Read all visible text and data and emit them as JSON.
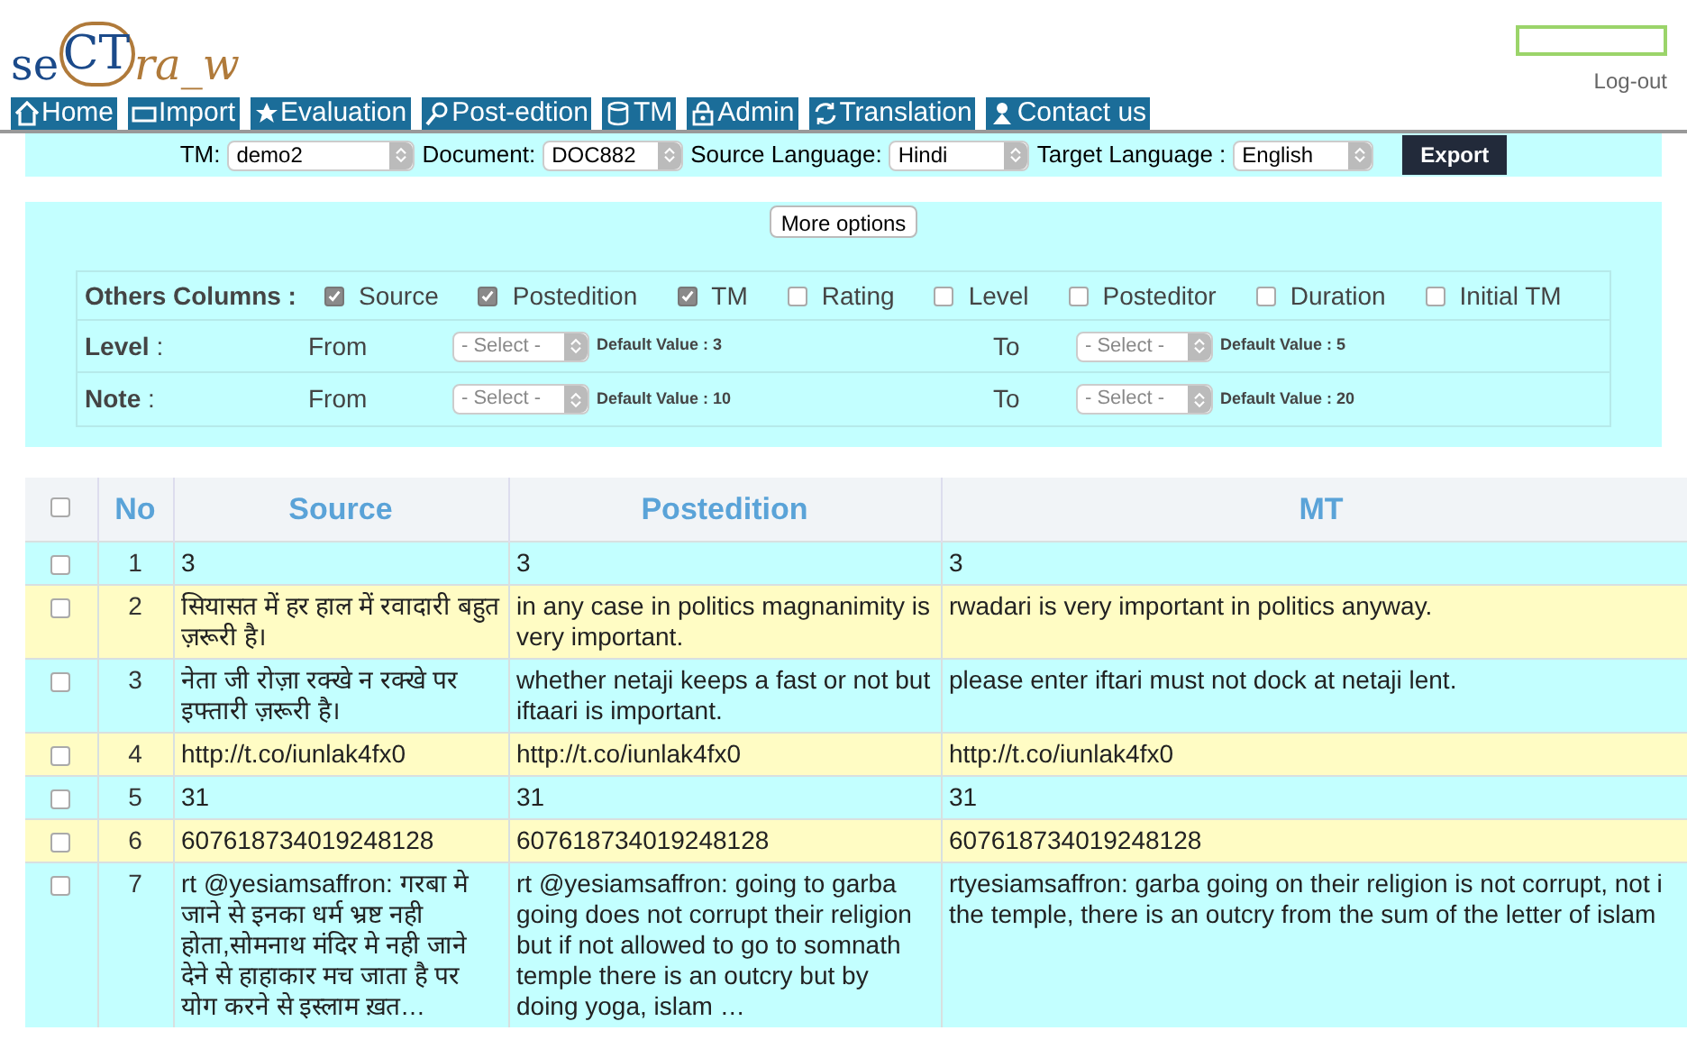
{
  "logo": {
    "text_start": "se",
    "text_circle": "CT",
    "text_end": "ra_w"
  },
  "logout": "Log-out",
  "nav": [
    {
      "label": "Home",
      "kind": "home"
    },
    {
      "label": "Import",
      "kind": "import"
    },
    {
      "label": "Evaluation",
      "kind": "star"
    },
    {
      "label": "Post-edtion",
      "kind": "search"
    },
    {
      "label": "TM",
      "kind": "db"
    },
    {
      "label": "Admin",
      "kind": "lock"
    },
    {
      "label": "Translation",
      "kind": "sync"
    },
    {
      "label": "Contact us",
      "kind": "person"
    }
  ],
  "toolbar": {
    "fields": [
      {
        "label": "TM:",
        "value": "demo2"
      },
      {
        "label": "Document:",
        "value": "DOC882"
      },
      {
        "label": "Source Language:",
        "value": "Hindi"
      },
      {
        "label": "Target Language :",
        "value": "English"
      }
    ],
    "export": "Export"
  },
  "more_options": "More options",
  "others_columns": {
    "label": "Others Columns :",
    "options": [
      {
        "label": "Source",
        "checked": true
      },
      {
        "label": "Postedition",
        "checked": true
      },
      {
        "label": "TM",
        "checked": true
      },
      {
        "label": "Rating",
        "checked": false
      },
      {
        "label": "Level",
        "checked": false
      },
      {
        "label": "Posteditor",
        "checked": false
      },
      {
        "label": "Duration",
        "checked": false
      },
      {
        "label": "Initial TM",
        "checked": false
      }
    ]
  },
  "filters": [
    {
      "label": "**Level** :",
      "from": "From",
      "from_select": "- Select -",
      "from_default": "Default Value : 3",
      "to": "To",
      "to_select": "- Select -",
      "to_default": "Default Value : 5"
    },
    {
      "label": "**Note** :",
      "from": "From",
      "from_select": "- Select -",
      "from_default": "Default Value : 10",
      "to": "To",
      "to_select": "- Select -",
      "to_default": "Default Value : 20"
    }
  ],
  "table": {
    "columns": [
      "No",
      "Source",
      "Postedition",
      "MT"
    ],
    "header_checked": false,
    "rows": [
      {
        "checked": false,
        "no": "1",
        "source": "3",
        "postedition": "3",
        "mt": "3"
      },
      {
        "checked": false,
        "no": "2",
        "source": "सियासत में हर हाल में रवादारी बहुत ज़रूरी है।",
        "postedition": "in any case in politics magnanimity is very important.",
        "mt": "rwadari is very important in politics anyway."
      },
      {
        "checked": false,
        "no": "3",
        "source": "नेता जी रोज़ा रक्खे न रक्खे पर इफ्तारी ज़रूरी है।",
        "postedition": "whether netaji keeps a fast or not but iftaari is important.",
        "mt": "please enter iftari must not dock at netaji lent."
      },
      {
        "checked": false,
        "no": "4",
        "source": "http://t.co/iunlak4fx0",
        "postedition": "http://t.co/iunlak4fx0",
        "mt": "http://t.co/iunlak4fx0"
      },
      {
        "checked": false,
        "no": "5",
        "source": "31",
        "postedition": "31",
        "mt": "31"
      },
      {
        "checked": false,
        "no": "6",
        "source": "607618734019248128",
        "postedition": "607618734019248128",
        "mt": "607618734019248128"
      },
      {
        "checked": false,
        "no": "7",
        "source": "rt @yesiamsaffron: गरबा मे जाने से इनका धर्म भ्रष्ट नही होता,सोमनाथ मंदिर मे नही जाने देने से हाहाकार मच जाता है पर योग करने से इस्लाम ख़त…",
        "postedition": "rt @yesiamsaffron: going to garba going does not corrupt their religion but if not allowed to go to somnath temple there is an outcry but by doing yoga, islam …",
        "mt": "rtyesiamsaffron: garba going on their religion is not corrupt, not i the temple, there is an outcry from the sum of the letter of islam"
      }
    ]
  }
}
